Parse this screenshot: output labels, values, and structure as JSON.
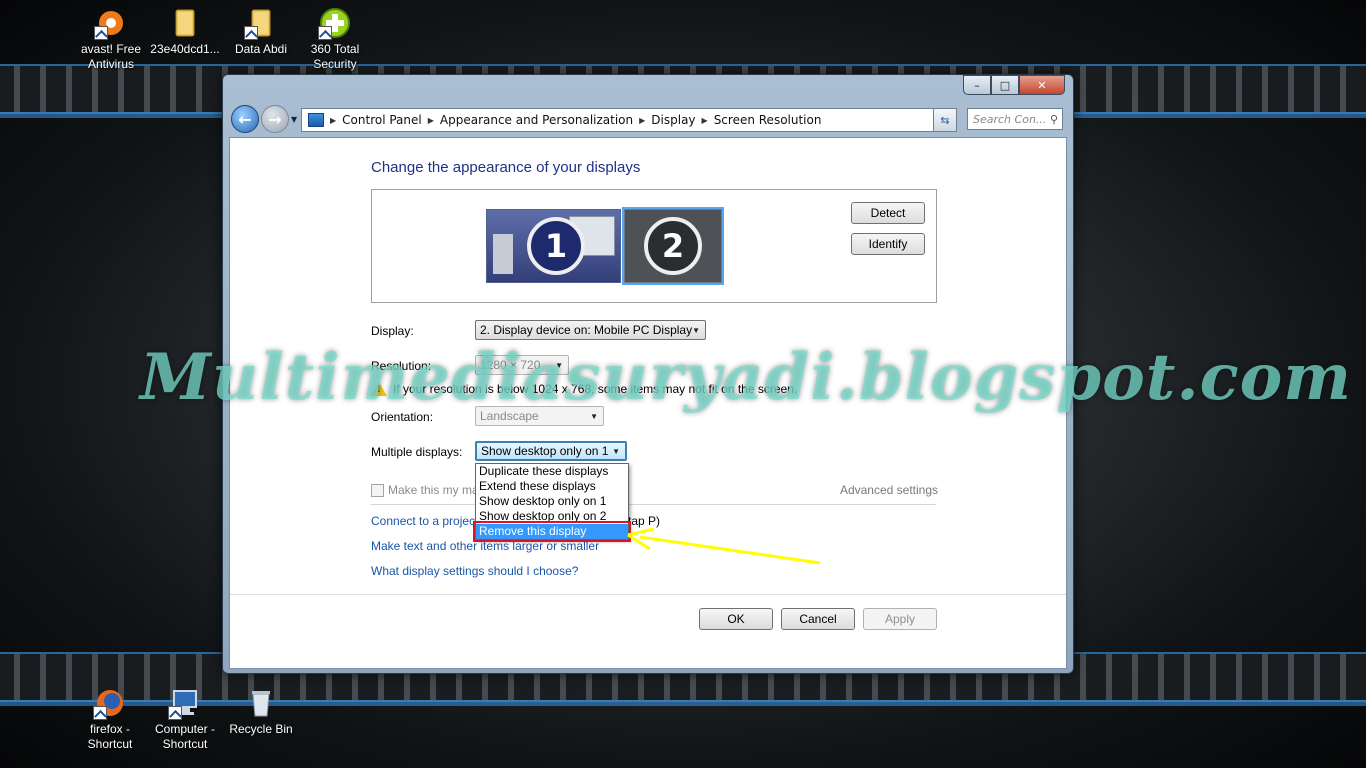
{
  "desktop": {
    "icons_top": [
      {
        "label": "avast! Free Antivirus",
        "line1": "avast! Free",
        "line2": "Antivirus"
      },
      {
        "label": "23e40dcd1...",
        "line1": "23e40dcd1...",
        "line2": ""
      },
      {
        "label": "Data Abdi",
        "line1": "Data Abdi",
        "line2": ""
      },
      {
        "label": "360 Total Security",
        "line1": "360 Total",
        "line2": "Security"
      }
    ],
    "icons_bottom": [
      {
        "line1": "firefox -",
        "line2": "Shortcut"
      },
      {
        "line1": "Computer -",
        "line2": "Shortcut"
      },
      {
        "line1": "Recycle Bin",
        "line2": ""
      }
    ]
  },
  "window": {
    "breadcrumb": [
      "Control Panel",
      "Appearance and Personalization",
      "Display",
      "Screen Resolution"
    ],
    "search_placeholder": "Search Con...",
    "caption": {
      "min": "–",
      "max": "□",
      "close": "✕"
    }
  },
  "content": {
    "title": "Change the appearance of your displays",
    "monitor1": "1",
    "monitor2": "2",
    "detect_label": "Detect",
    "identify_label": "Identify",
    "display_label": "Display:",
    "display_value": "2. Display device on: Mobile PC Display",
    "resolution_label": "Resolution:",
    "resolution_value": "1280 × 720",
    "warning_text": "If your resolution is below 1024 x 768, some items may not fit on the screen.",
    "orientation_label": "Orientation:",
    "orientation_value": "Landscape",
    "multiple_label": "Multiple displays:",
    "multiple_value": "Show desktop only on 1",
    "make_main_label": "Make this my ma",
    "advanced_label": "Advanced settings",
    "dropdown_options": [
      "Duplicate these displays",
      "Extend these displays",
      "Show desktop only on 1",
      "Show desktop only on 2",
      "Remove this display"
    ],
    "selected_option": "Remove this display",
    "link_projector_a": "Connect to a projec",
    "link_projector_b": "tap P)",
    "link_text_size": "Make text and other items larger or smaller",
    "link_help": "What display settings should I choose?",
    "ok_label": "OK",
    "cancel_label": "Cancel",
    "apply_label": "Apply"
  },
  "watermark": "Multimediasuryadi.blogspot.com",
  "colors": {
    "link": "#1a56a6",
    "title": "#1e3287",
    "highlight": "#3399ff",
    "annotation_yellow": "#ffff00",
    "annotation_red": "#e0141e"
  }
}
